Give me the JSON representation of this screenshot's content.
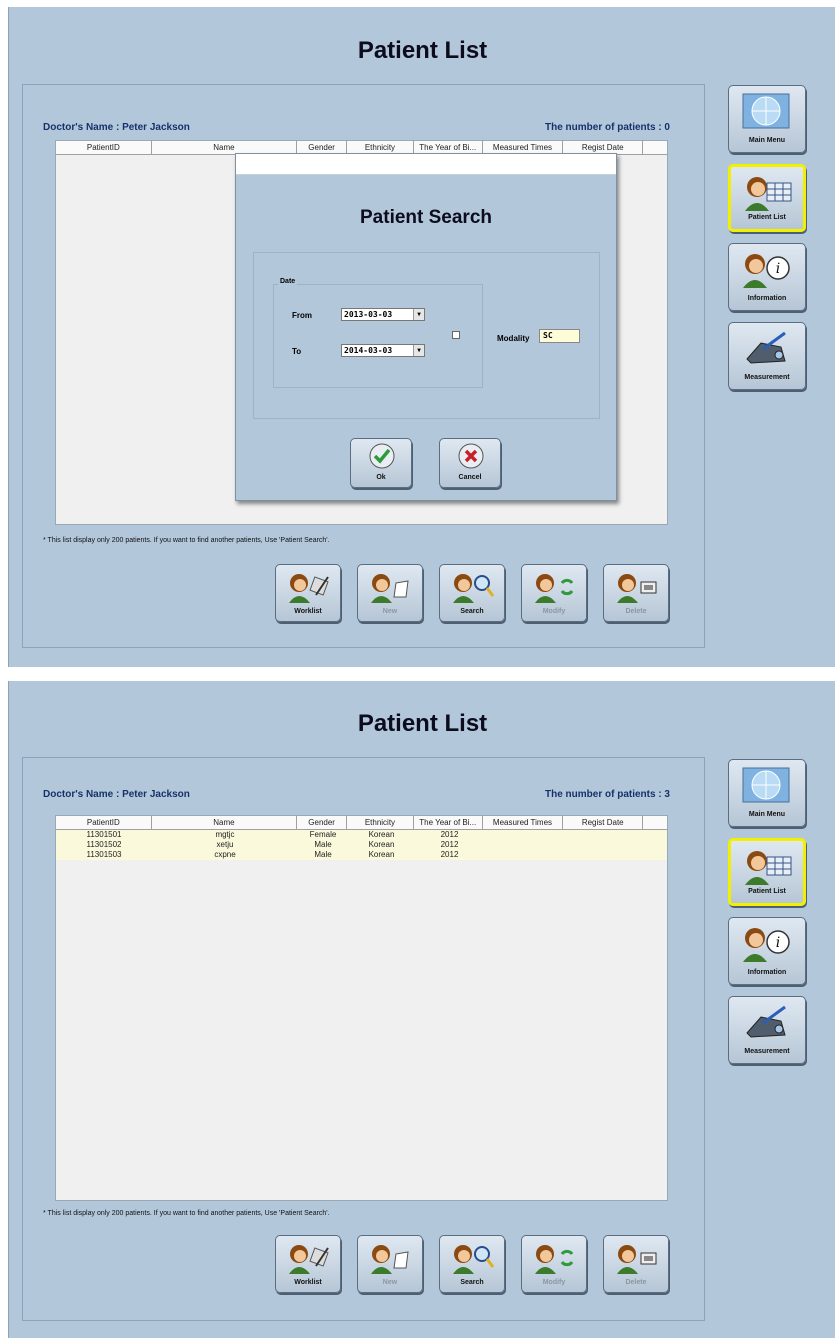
{
  "screens": [
    {
      "title": "Patient List",
      "doctor": "Doctor's Name : Peter Jackson",
      "count": "The number of patients : 0",
      "columns": [
        "PatientID",
        "Name",
        "Gender",
        "Ethnicity",
        "The Year of Bi...",
        "Measured Times",
        "Regist Date"
      ],
      "rows": [],
      "note": "* This list display only 200 patients. If you want to find another patients, Use 'Patient Search'.",
      "dialog": {
        "title": "Patient Search",
        "group_label": "Date",
        "from_label": "From",
        "from_value": "2013-03-03",
        "to_label": "To",
        "to_value": "2014-03-03",
        "modality_label": "Modality",
        "modality_value": "SC",
        "ok_label": "Ok",
        "cancel_label": "Cancel"
      }
    },
    {
      "title": "Patient List",
      "doctor": "Doctor's Name : Peter Jackson",
      "count": "The number of patients : 3",
      "columns": [
        "PatientID",
        "Name",
        "Gender",
        "Ethnicity",
        "The Year of Bi...",
        "Measured Times",
        "Regist Date"
      ],
      "rows": [
        {
          "id": "11301501",
          "name": "mgtjc",
          "gender": "Female",
          "ethnicity": "Korean",
          "year": "2012",
          "measured": "",
          "regist": ""
        },
        {
          "id": "11301502",
          "name": "xetju",
          "gender": "Male",
          "ethnicity": "Korean",
          "year": "2012",
          "measured": "",
          "regist": ""
        },
        {
          "id": "11301503",
          "name": "cxpne",
          "gender": "Male",
          "ethnicity": "Korean",
          "year": "2012",
          "measured": "",
          "regist": ""
        }
      ],
      "note": "* This list display only 200 patients. If you want to find another patients, Use 'Patient Search'."
    }
  ],
  "bottom_buttons": [
    {
      "label": "Worklist",
      "enabled": true,
      "icon": "worklist-icon"
    },
    {
      "label": "New",
      "enabled": false,
      "icon": "new-patient-icon"
    },
    {
      "label": "Search",
      "enabled": true,
      "icon": "search-icon"
    },
    {
      "label": "Modify",
      "enabled": false,
      "icon": "modify-icon"
    },
    {
      "label": "Delete",
      "enabled": false,
      "icon": "delete-icon"
    }
  ],
  "side_menu": [
    {
      "label": "Main Menu",
      "active": false,
      "icon": "globe-icon"
    },
    {
      "label": "Patient List",
      "active": true,
      "icon": "patient-list-icon"
    },
    {
      "label": "Information",
      "active": false,
      "icon": "info-icon"
    },
    {
      "label": "Measurement",
      "active": false,
      "icon": "measurement-icon"
    }
  ],
  "colors": {
    "background": "#b3c7db",
    "title_text": "#0c0c1e",
    "header_text": "#17326b",
    "row_highlight": "#fbf9dc",
    "active_border": "#f0f000"
  }
}
